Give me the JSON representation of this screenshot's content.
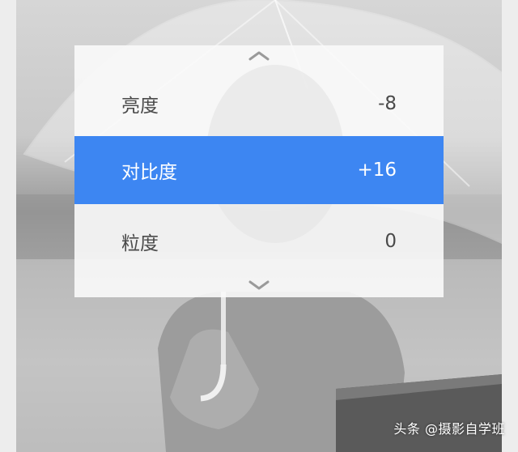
{
  "adjust_panel": {
    "scroll_up_icon": "chevron-up-icon",
    "scroll_down_icon": "chevron-down-icon",
    "items": [
      {
        "label": "亮度",
        "value": "-8",
        "selected": false
      },
      {
        "label": "对比度",
        "value": "+16",
        "selected": true
      },
      {
        "label": "粒度",
        "value": "0",
        "selected": false
      }
    ]
  },
  "watermark": {
    "text": "头条 @摄影自学班"
  },
  "colors": {
    "selected_row": "#3d86f2",
    "panel_bg": "#fafafa",
    "label_text": "#4a4a4a"
  }
}
